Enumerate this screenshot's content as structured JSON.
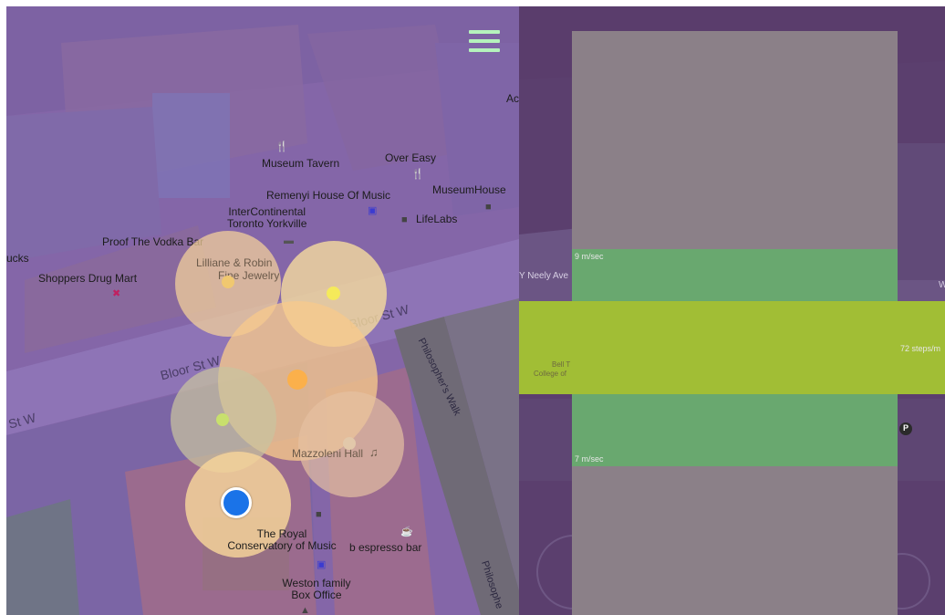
{
  "map": {
    "places": {
      "museum_tavern": "Museum Tavern",
      "over_easy": "Over Easy",
      "remenyi": "Remenyi House Of Music",
      "museum_house": "MuseumHouse",
      "intercontinental": "InterContinental\nToronto Yorkville",
      "lifelabs": "LifeLabs",
      "proof": "Proof The Vodka Bar",
      "lilliane": "Lilliane & Robin",
      "fine_jewelry": "Fine Jewelry",
      "shoppers": "Shoppers Drug Mart",
      "ucks": "ucks",
      "ac": "Ac",
      "mazzoleni": "Mazzoleni Hall",
      "royal_conservatory": "The Royal\nConservatory of Music",
      "espresso": "b espresso bar",
      "weston": "Weston family\nBox Office"
    },
    "roads": {
      "bloor_upper": "Bloor St W",
      "bloor_lower": "Bloor St W",
      "st_w_left": "St W",
      "philosophers_walk": "Philosopher's Walk",
      "philosophe": "Philosophe"
    }
  },
  "menu": {
    "icon": "hamburger-menu-icon",
    "color": "#b5f2bc"
  },
  "right_map": {
    "neely": "Y Neely Ave",
    "w_edge": "W",
    "bell": "Bell T",
    "college": "College of",
    "parking": "P"
  },
  "speed_panel": {
    "upper_label": "9 m/sec",
    "lower_label": "7 m/sec",
    "cadence_label": "72 steps/m",
    "band_color": "#69a86f",
    "target_color": "#a1be35"
  },
  "location_marker": {
    "color": "#1a73e8"
  },
  "circles": [
    {
      "name": "sound-circle-1",
      "fill": "#f5d39a",
      "dot": "#f0c870"
    },
    {
      "name": "sound-circle-2",
      "fill": "#f6dc9e",
      "dot": "#f5ea5a"
    },
    {
      "name": "sound-circle-3",
      "fill": "#f6c98c",
      "dot": "#fbb04b"
    },
    {
      "name": "sound-circle-4",
      "fill": "#c9c4a0",
      "dot": "#c8e06d"
    },
    {
      "name": "sound-circle-5",
      "fill": "#e5c0a1",
      "dot": "#e2c8aa"
    },
    {
      "name": "sound-circle-6",
      "fill": "#f5d29a",
      "dot": "#1a73e8"
    }
  ]
}
